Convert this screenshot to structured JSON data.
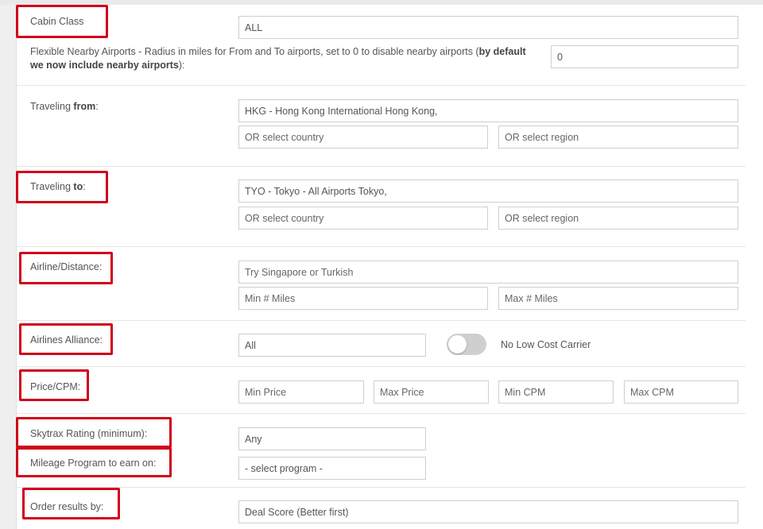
{
  "form": {
    "cabin_class": {
      "label": "Cabin Class",
      "value": "ALL"
    },
    "nearby": {
      "label_prefix": "Flexible Nearby Airports - Radius in miles for From and To airports, set to 0 to disable nearby airports (",
      "label_bold": "by default we now include nearby airports",
      "label_suffix": "):",
      "value": "0"
    },
    "from": {
      "label_prefix": "Traveling ",
      "label_bold": "from",
      "label_suffix": ":",
      "value": "HKG - Hong Kong International Hong Kong,",
      "country_placeholder": "OR select country",
      "region_placeholder": "OR select region"
    },
    "to": {
      "label_prefix": "Traveling ",
      "label_bold": "to",
      "label_suffix": ":",
      "value": "TYO - Tokyo - All Airports Tokyo,",
      "country_placeholder": "OR select country",
      "region_placeholder": "OR select region"
    },
    "airline": {
      "label": "Airline/Distance:",
      "placeholder": "Try Singapore or Turkish",
      "min_miles_placeholder": "Min # Miles",
      "max_miles_placeholder": "Max # Miles"
    },
    "alliance": {
      "label": "Airlines Alliance:",
      "value": "All",
      "toggle_label": "No Low Cost Carrier"
    },
    "price": {
      "label": "Price/CPM:",
      "min_price_placeholder": "Min Price",
      "max_price_placeholder": "Max Price",
      "min_cpm_placeholder": "Min CPM",
      "max_cpm_placeholder": "Max CPM"
    },
    "skytrax": {
      "label": "Skytrax Rating (minimum):",
      "value": "Any"
    },
    "mileage": {
      "label": "Mileage Program to earn on:",
      "value": "- select program -"
    },
    "order": {
      "label": "Order results by:",
      "value": "Deal Score (Better first)"
    }
  },
  "colors": {
    "highlight": "#d0021b",
    "toggle_off": "#cfcfcf"
  }
}
